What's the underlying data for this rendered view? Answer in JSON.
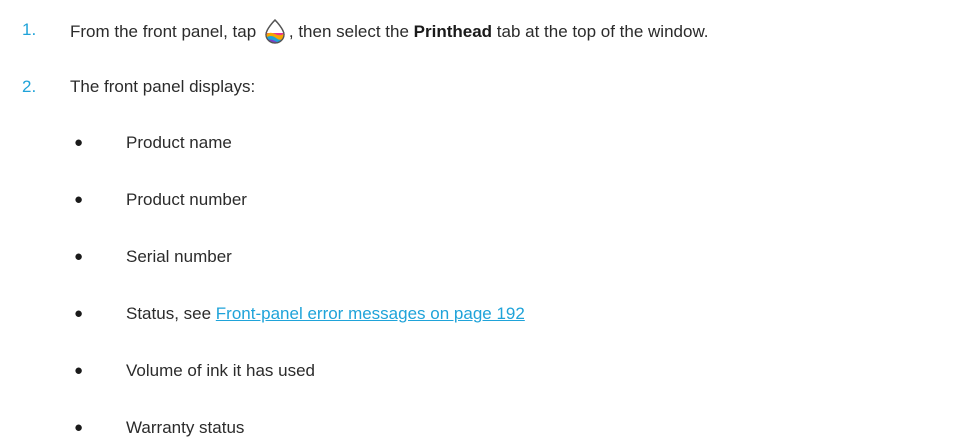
{
  "steps": [
    {
      "number": "1.",
      "text_before_icon": "From the front panel, tap",
      "icon": "ink-drop-icon",
      "text_after_icon": ", then select the",
      "bold_term": "Printhead",
      "text_end": "tab at the top of the window."
    },
    {
      "number": "2.",
      "text": "The front panel displays:"
    }
  ],
  "bullets": [
    {
      "text": "Product name"
    },
    {
      "text": "Product number"
    },
    {
      "text": "Serial number"
    },
    {
      "text": "Status, see",
      "link": "Front-panel error messages on page 192"
    },
    {
      "text": "Volume of ink it has used"
    },
    {
      "text": "Warranty status"
    }
  ],
  "bullet_glyph": "●",
  "colors": {
    "accent": "#1fa3d9",
    "text": "#2b2b2b",
    "icon_drop": [
      "#e8368f",
      "#f7c600",
      "#1fa3d9"
    ]
  }
}
